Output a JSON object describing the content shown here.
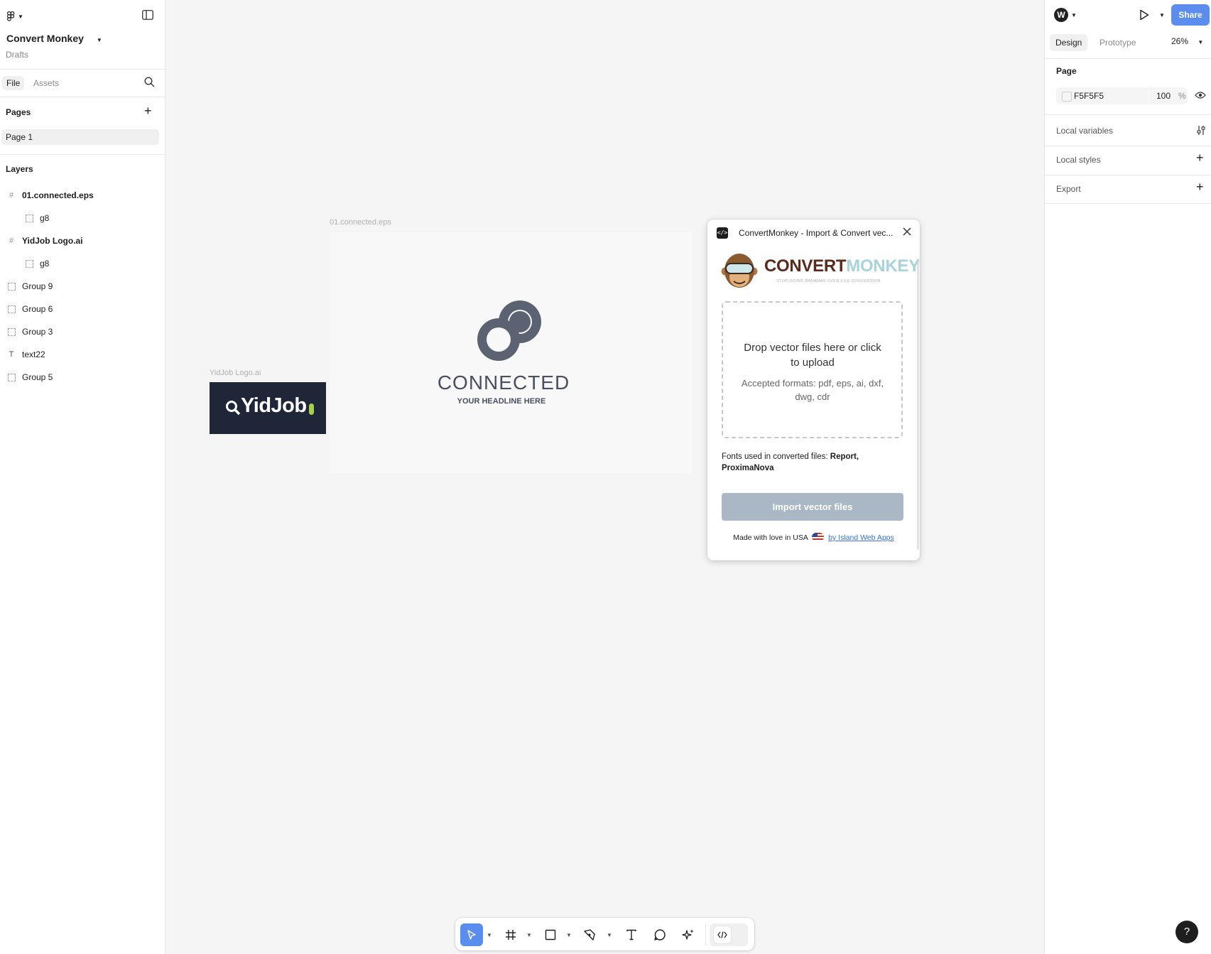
{
  "left_panel": {
    "project_title": "Convert Monkey",
    "project_location": "Drafts",
    "tabs": [
      "File",
      "Assets"
    ],
    "pages_header": "Pages",
    "pages": [
      "Page 1"
    ],
    "layers_header": "Layers",
    "layers": [
      {
        "name": "01.connected.eps",
        "type": "frame",
        "indent": 0,
        "bold": true
      },
      {
        "name": "g8",
        "type": "group",
        "indent": 1,
        "bold": false
      },
      {
        "name": "YidJob Logo.ai",
        "type": "frame",
        "indent": 0,
        "bold": true
      },
      {
        "name": "g8",
        "type": "group",
        "indent": 1,
        "bold": false
      },
      {
        "name": "Group 9",
        "type": "group",
        "indent": 0,
        "bold": false
      },
      {
        "name": "Group 6",
        "type": "group",
        "indent": 0,
        "bold": false
      },
      {
        "name": "Group 3",
        "type": "group",
        "indent": 0,
        "bold": false
      },
      {
        "name": "text22",
        "type": "text",
        "indent": 0,
        "bold": false
      },
      {
        "name": "Group 5",
        "type": "group",
        "indent": 0,
        "bold": false
      }
    ]
  },
  "right_panel": {
    "share_label": "Share",
    "tabs": [
      "Design",
      "Prototype"
    ],
    "zoom": "26%",
    "page_section": "Page",
    "page_color": "F5F5F5",
    "page_opacity": "100",
    "opacity_unit": "%",
    "sections": [
      "Local variables",
      "Local styles",
      "Export"
    ]
  },
  "canvas": {
    "frame1_label": "01.connected.eps",
    "frame2_label": "YidJob Logo.ai",
    "connected_title": "CONNECTED",
    "connected_subtitle": "YOUR HEADLINE HERE",
    "yidjob_text": "YidJob"
  },
  "plugin": {
    "title": "ConvertMonkey - Import & Convert vec...",
    "logo_word1": "CONVERT",
    "logo_word2": "MONKEY",
    "logo_tagline": "STOP GOING BANANAS OVER FILE CONVERSION",
    "drop_title": "Drop vector files here or click to upload",
    "drop_formats": "Accepted formats: pdf, eps, ai, dxf, dwg, cdr",
    "fonts_prefix": "Fonts used in converted files: ",
    "fonts_list": "Report, ProximaNova",
    "import_button": "Import vector files",
    "footer_text": "Made with love in USA",
    "footer_link": "by Island Web Apps"
  },
  "help_label": "?"
}
